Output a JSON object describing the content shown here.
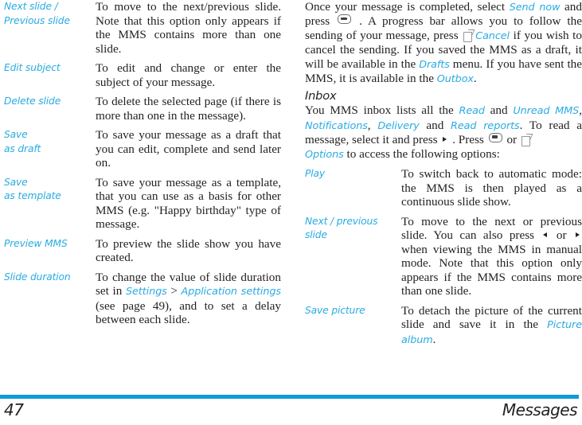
{
  "page": {
    "number": "47",
    "section": "Messages",
    "accent_color": "#29abe2",
    "rule_color": "#0f9bd7",
    "text_color": "#231f20"
  },
  "left_column": {
    "options_table": [
      {
        "term": "Next slide / Previous slide",
        "term_line1": "Next slide /",
        "term_line2": "Previous slide",
        "description": "To move to the next/previous slide. Note that this option only appears if the MMS contains more than one slide."
      },
      {
        "term": "Edit subject",
        "term_line1": "Edit subject",
        "term_line2": "",
        "description": "To edit and change or enter the subject of your message."
      },
      {
        "term": "Delete slide",
        "term_line1": "Delete slide",
        "term_line2": "",
        "description": "To delete the selected page (if there is more than one in the message)."
      },
      {
        "term": "Save as draft",
        "term_line1": "Save",
        "term_line2": "as draft",
        "description": "To save your message as a draft that you can edit, complete and send later on."
      },
      {
        "term": "Save as template",
        "term_line1": "Save",
        "term_line2": "as template",
        "description": "To save your message as a template, that you can use as a basis for other MMS (e.g. \"Happy birthday\" type of message."
      },
      {
        "term": "Preview MMS",
        "term_line1": "Preview MMS",
        "term_line2": "",
        "description": "To preview the slide show you have created."
      },
      {
        "term": "Slide duration",
        "term_line1": "Slide duration",
        "term_line2": "",
        "desc_part1": "To change the value of slide duration set in ",
        "desc_link1": "Settings",
        "desc_part2": " > ",
        "desc_link2": "Application settings",
        "desc_part3": " (see page 49), and to set a delay between each slide."
      }
    ]
  },
  "right_column": {
    "intro_paragraph": {
      "part1": "Once your message is completed, select ",
      "link1": "Send now",
      "part2": " and press ",
      "icon1": "ok-key-icon",
      "part3": " . A progress bar allows you to follow the sending of your message, press ",
      "icon2": "soft-key-icon",
      "link2": "Cancel",
      "part4": " if you wish to cancel the sending. If you saved the MMS as a draft, it will be available in the ",
      "link3": "Drafts",
      "part5": " menu. If you have sent the MMS, it is available in the ",
      "link4": "Outbox",
      "part6": "."
    },
    "heading": "Inbox",
    "inbox_paragraph": {
      "part1": "You MMS inbox lists all the ",
      "link1": "Read",
      "part2": " and ",
      "link2": "Unread MMS",
      "part3": ", ",
      "link3": "Notifications",
      "part4": ", ",
      "link4": "Delivery",
      "part5": " and ",
      "link5": "Read reports",
      "part6": ". To read a message, select it and press ",
      "icon1": "arrow-right-icon",
      "part7": " . Press ",
      "icon2": "ok-key-icon",
      "part8": " or ",
      "icon3": "soft-key-icon",
      "link6": "Options",
      "part9": " to access the following options:"
    },
    "options_table": [
      {
        "term": "Play",
        "term_line1": "Play",
        "term_line2": "",
        "description": "To switch back to automatic mode: the MMS is then played as a continuous slide show."
      },
      {
        "term": "Next / previous slide",
        "term_line1": "Next / previous",
        "term_line2": "slide",
        "desc_part1": "To move to the next or previous slide. You can also press ",
        "icon1": "arrow-left-icon",
        "desc_part2": " or ",
        "icon2": "arrow-right-icon",
        "desc_part3": " when viewing the MMS in manual mode. Note that this option only appears if the MMS contains more than one slide."
      },
      {
        "term": "Save picture",
        "term_line1": "Save picture",
        "term_line2": "",
        "desc_part1": "To detach the picture of the current slide and save it in the ",
        "desc_link1": "Picture album",
        "desc_part2": "."
      }
    ]
  }
}
